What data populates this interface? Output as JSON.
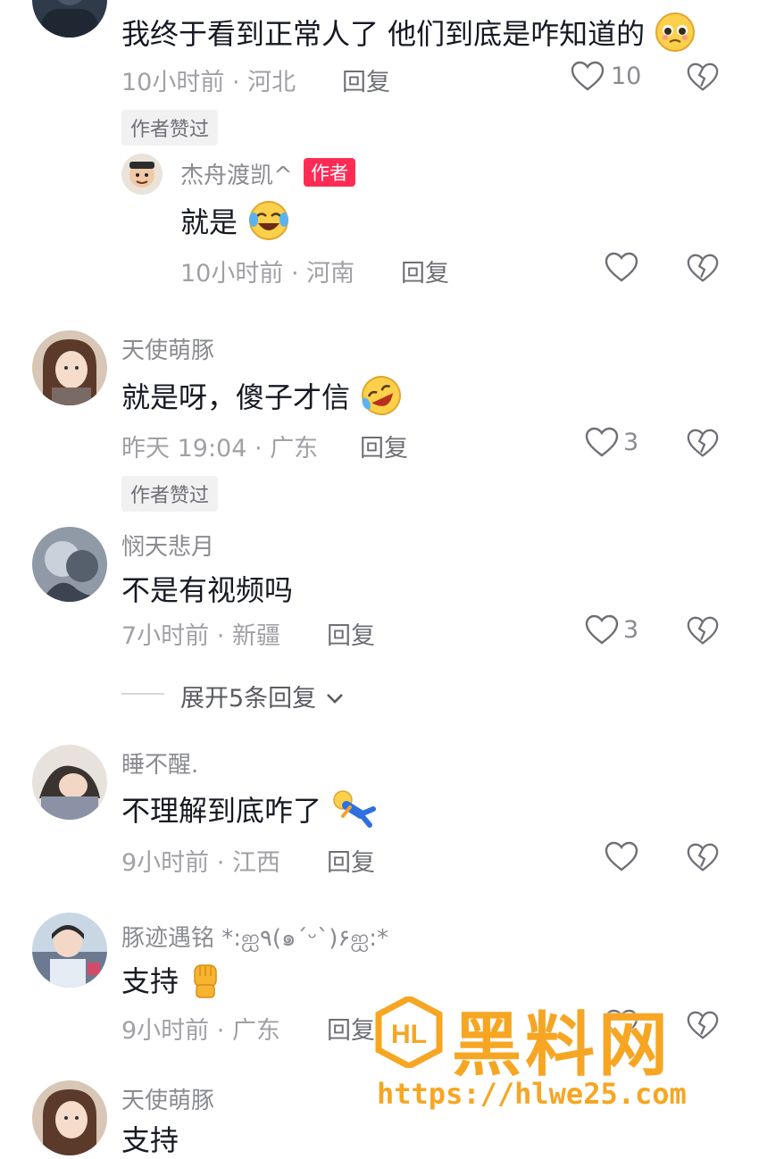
{
  "comments": [
    {
      "text": "我终于看到正常人了 他们到底是咋知道的",
      "emoji": "pleading-face",
      "time": "10小时前",
      "location": "河北",
      "reply_label": "回复",
      "like_count": "10",
      "liked_badge": "作者赞过"
    },
    {
      "username": "杰舟渡凯^",
      "author_badge": "作者",
      "text": "就是",
      "emoji": "crying-laughing-face",
      "time": "10小时前",
      "location": "河南",
      "reply_label": "回复"
    },
    {
      "username": "天使萌豚",
      "text": "就是呀，傻子才信",
      "emoji": "rolling-laughing-face",
      "time": "昨天 19:04",
      "location": "广东",
      "reply_label": "回复",
      "like_count": "3",
      "liked_badge": "作者赞过"
    },
    {
      "username": "悯天悲月",
      "text": "不是有视频吗",
      "time": "7小时前",
      "location": "新疆",
      "reply_label": "回复",
      "like_count": "3",
      "expand_label": "展开5条回复"
    },
    {
      "username": "睡不醒.",
      "text": "不理解到底咋了",
      "emoji": "falling-person",
      "time": "9小时前",
      "location": "江西",
      "reply_label": "回复"
    },
    {
      "username": "豚迹遇铭 *:ஐ٩(๑´ᵕ`)۶ஐ:*",
      "text": "支持",
      "emoji": "raised-fist",
      "time": "9小时前",
      "location": "广东",
      "reply_label": "回复"
    },
    {
      "username": "天使萌豚",
      "text": "支持"
    }
  ],
  "separator": "·",
  "watermark": {
    "brand": "黑料网",
    "url": "https://hlwe25.com",
    "logo_letters": "HL",
    "color": "#f6a623"
  },
  "colors": {
    "author_badge": "#fe2c55",
    "meta_text": "#a0a1a6",
    "username": "#8a8b91"
  }
}
